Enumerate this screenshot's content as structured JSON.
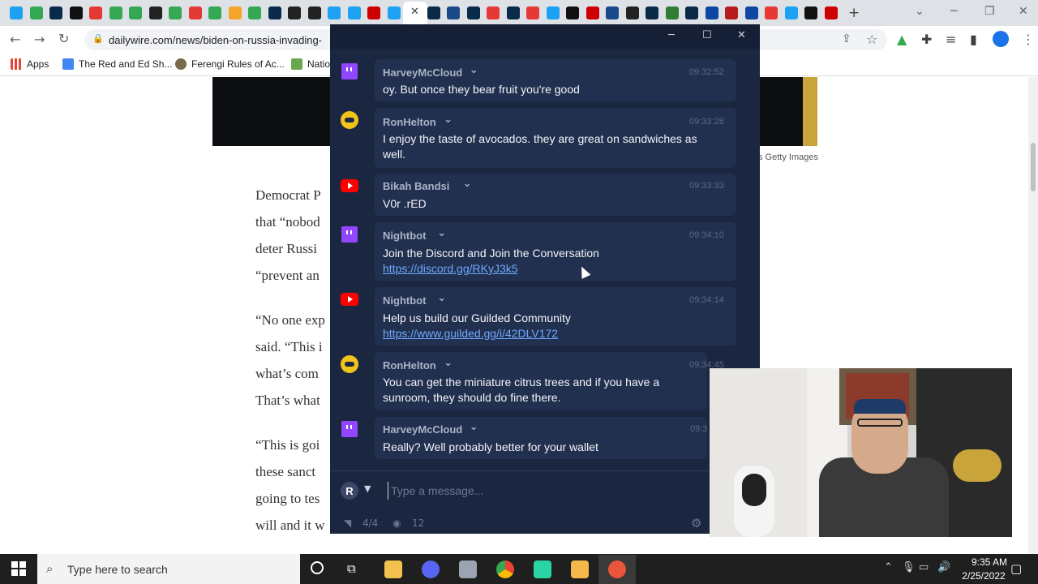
{
  "browser": {
    "url": "dailywire.com/news/biden-on-russia-invading-",
    "tab_favicons": [
      "twitter",
      "grid",
      "DW",
      "circle",
      "news",
      "grid",
      "grid",
      "A",
      "grid",
      "news",
      "grid",
      "gear",
      "map",
      "DW",
      "bbc",
      "bbc",
      "twitter",
      "twitter",
      "CNN",
      "twitter",
      "close",
      "DW",
      "cbs",
      "DW",
      "news",
      "DW",
      "news",
      "twitter",
      "dots",
      "CNN",
      "cbs",
      "bbc",
      "DW",
      "W",
      "DW",
      "V",
      "P",
      "V",
      "news",
      "twitter",
      "dots",
      "CNN"
    ],
    "bookmarks": [
      {
        "label": "Apps",
        "icon": "apps-grid-icon"
      },
      {
        "label": "The Red and Ed Sh...",
        "icon": "doc-icon"
      },
      {
        "label": "Ferengi Rules of Ac...",
        "icon": "ferengi-icon"
      },
      {
        "label": "Natio",
        "icon": "shield-icon"
      }
    ]
  },
  "article": {
    "image_credit": "s Getty Images",
    "paragraphs": [
      "Democrat P",
      "that “nobod",
      "deter Russi",
      "“prevent an",
      "“No one exp",
      "said. “This i",
      "what’s com",
      "That’s what",
      "“This is goi",
      "these sanct",
      "going to tes",
      "will and it w"
    ]
  },
  "chat": {
    "messages": [
      {
        "platform": "twitch",
        "user": "HarveyMcCloud",
        "time": "09:32:52",
        "lines": [
          "oy. But once they bear fruit you're good"
        ],
        "link": ""
      },
      {
        "platform": "trovo",
        "user": "RonHelton",
        "time": "09:33:28",
        "lines": [
          "I enjoy the taste of avocados. they are great on sandwiches as",
          "well."
        ],
        "link": ""
      },
      {
        "platform": "youtube",
        "user": "Bikah Bandsi",
        "time": "09:33:33",
        "lines": [
          "V0r .rED"
        ],
        "link": ""
      },
      {
        "platform": "twitch",
        "user": "Nightbot",
        "time": "09:34:10",
        "lines": [
          "Join the Discord and Join the Conversation"
        ],
        "link": "https://discord.gg/RKyJ3k5"
      },
      {
        "platform": "youtube",
        "user": "Nightbot",
        "time": "09:34:14",
        "lines": [
          "Help us build our Guilded Community"
        ],
        "link": "https://www.guilded.gg/i/42DLV172"
      },
      {
        "platform": "trovo",
        "user": "RonHelton",
        "time": "09:34:45",
        "lines": [
          "You can get the miniature citrus trees and if you have a",
          "sunroom, they should do fine there."
        ],
        "link": ""
      },
      {
        "platform": "twitch",
        "user": "HarveyMcCloud",
        "time": "09:3",
        "lines": [
          "Really? Well probably better for your wallet"
        ],
        "link": ""
      }
    ],
    "input_placeholder": "Type a message...",
    "avatar_letter": "R",
    "footer": {
      "feeds": "4/4",
      "viewers": "12"
    }
  },
  "taskbar": {
    "search_placeholder": "Type here to search",
    "time": "9:35 AM",
    "date": "2/25/2022"
  },
  "colors": {
    "chat_bg": "#1b2741",
    "message_bg": "#22304f",
    "twitch": "#9146ff",
    "youtube": "#ff0000",
    "trovo": "#f0c419",
    "link": "#6ea8ff"
  }
}
